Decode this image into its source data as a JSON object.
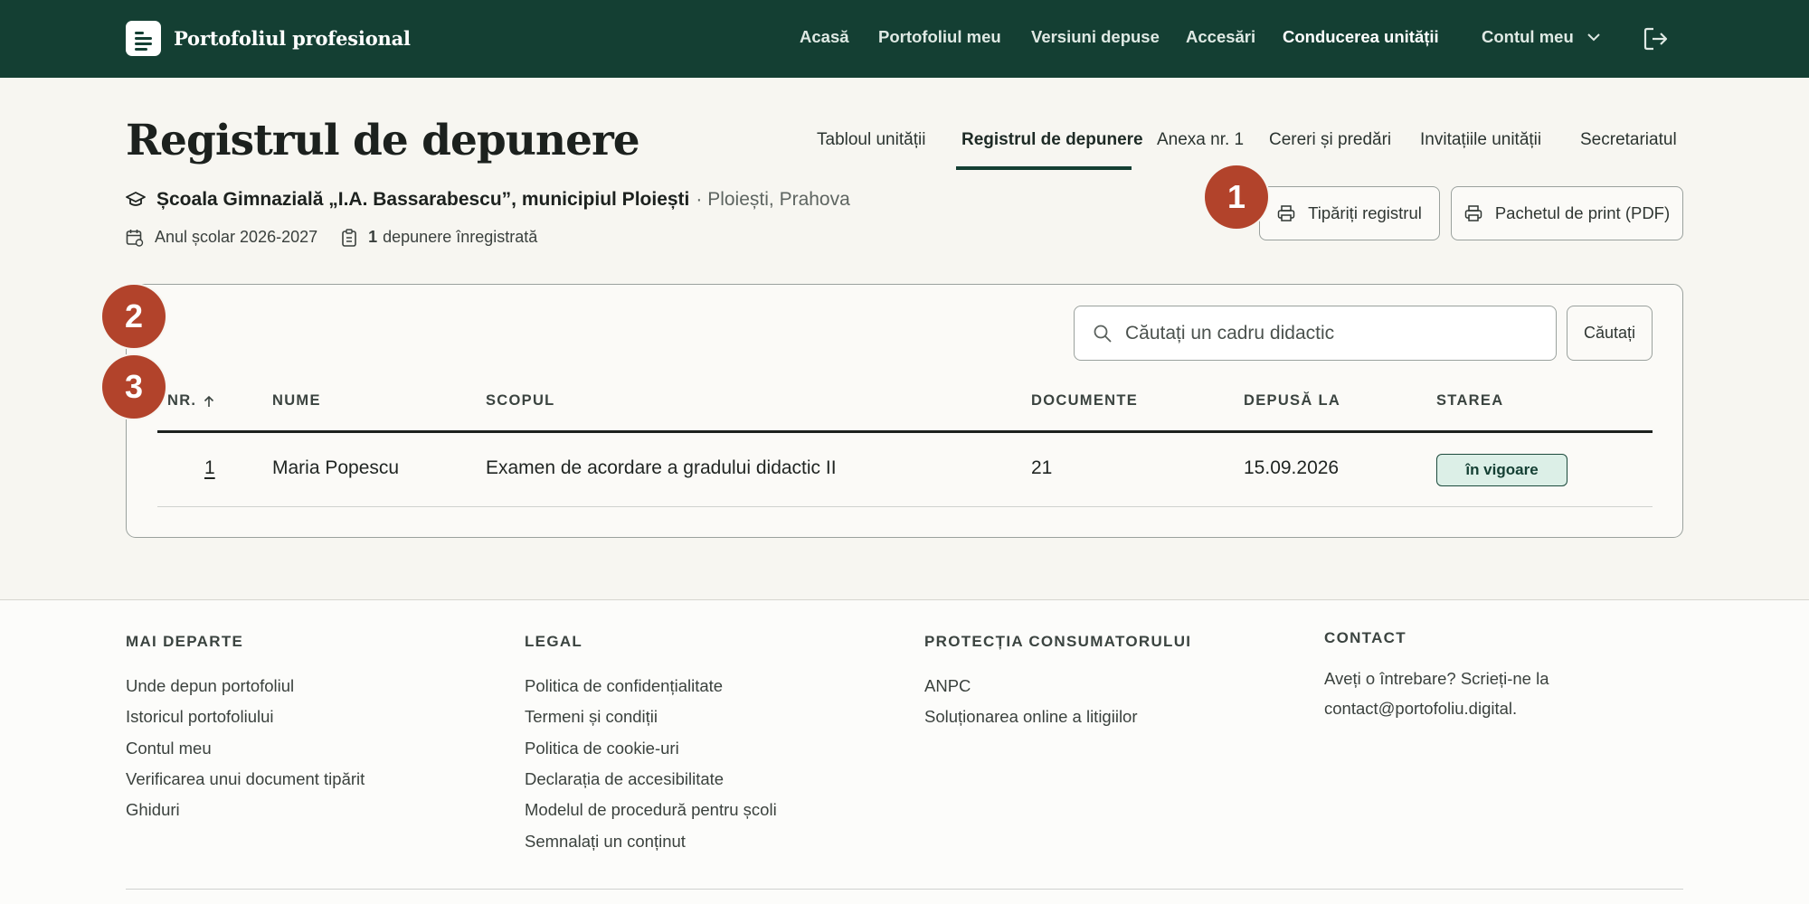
{
  "header": {
    "brand": "Portofoliul profesional",
    "nav": [
      {
        "label": "Acasă",
        "name": "nav-acasa"
      },
      {
        "label": "Portofoliul meu",
        "name": "nav-portofoliul-meu"
      },
      {
        "label": "Versiuni depuse",
        "name": "nav-versiuni-depuse"
      },
      {
        "label": "Accesări",
        "name": "nav-accesari"
      },
      {
        "label": "Conducerea unității",
        "name": "nav-conducerea-unitatii",
        "active": true
      }
    ],
    "account": "Contul meu"
  },
  "page": {
    "title": "Registrul de depunere",
    "tabs": [
      "Tabloul unității",
      "Registrul de depunere",
      "Anexa nr. 1",
      "Cereri și predări",
      "Invitațiile unității",
      "Secretariatul"
    ],
    "active_tab": "Registrul de depunere",
    "school_name": "Școala Gimnazială „I.A. Bassarabescu”, municipiul Ploiești",
    "school_location": "· Ploiești, Prahova",
    "school_year": "Anul școlar 2026-2027",
    "submissions_count": "1",
    "submissions_label": "depunere înregistrată"
  },
  "actions": {
    "print_register": "Tipăriți registrul",
    "print_package": "Pachetul de print (PDF)"
  },
  "search": {
    "placeholder": "Căutați un cadru didactic",
    "button": "Căutați"
  },
  "table": {
    "columns": [
      "NR.",
      "NUME",
      "SCOPUL",
      "DOCUMENTE",
      "DEPUSĂ LA",
      "STAREA"
    ],
    "rows": [
      {
        "nr": "1",
        "nume": "Maria Popescu",
        "scopul": "Examen de acordare a gradului didactic II",
        "documente": "21",
        "depusa_la": "15.09.2026",
        "starea": "în vigoare"
      }
    ]
  },
  "badges": [
    "1",
    "2",
    "3"
  ],
  "footer": {
    "col1": {
      "title": "MAI DEPARTE",
      "links": [
        "Unde depun portofoliul",
        "Istoricul portofoliului",
        "Contul meu",
        "Verificarea unui document tipărit",
        "Ghiduri"
      ]
    },
    "col2": {
      "title": "LEGAL",
      "links": [
        "Politica de confidențialitate",
        "Termeni și condiții",
        "Politica de cookie-uri",
        "Declarația de accesibilitate",
        "Modelul de procedură pentru școli",
        "Semnalați un conținut"
      ]
    },
    "col3": {
      "title": "PROTECȚIA CONSUMATORULUI",
      "links": [
        "ANPC",
        "Soluționarea online a litigiilor"
      ]
    },
    "col4": {
      "title": "CONTACT",
      "text": "Aveți o întrebare? Scrieți-ne la contact@portofoliu.digital."
    }
  },
  "colors": {
    "header_bg": "#143f33",
    "page_bg": "#f7f6f1",
    "badge": "#b2432b",
    "status_bg": "#dcefe7"
  }
}
